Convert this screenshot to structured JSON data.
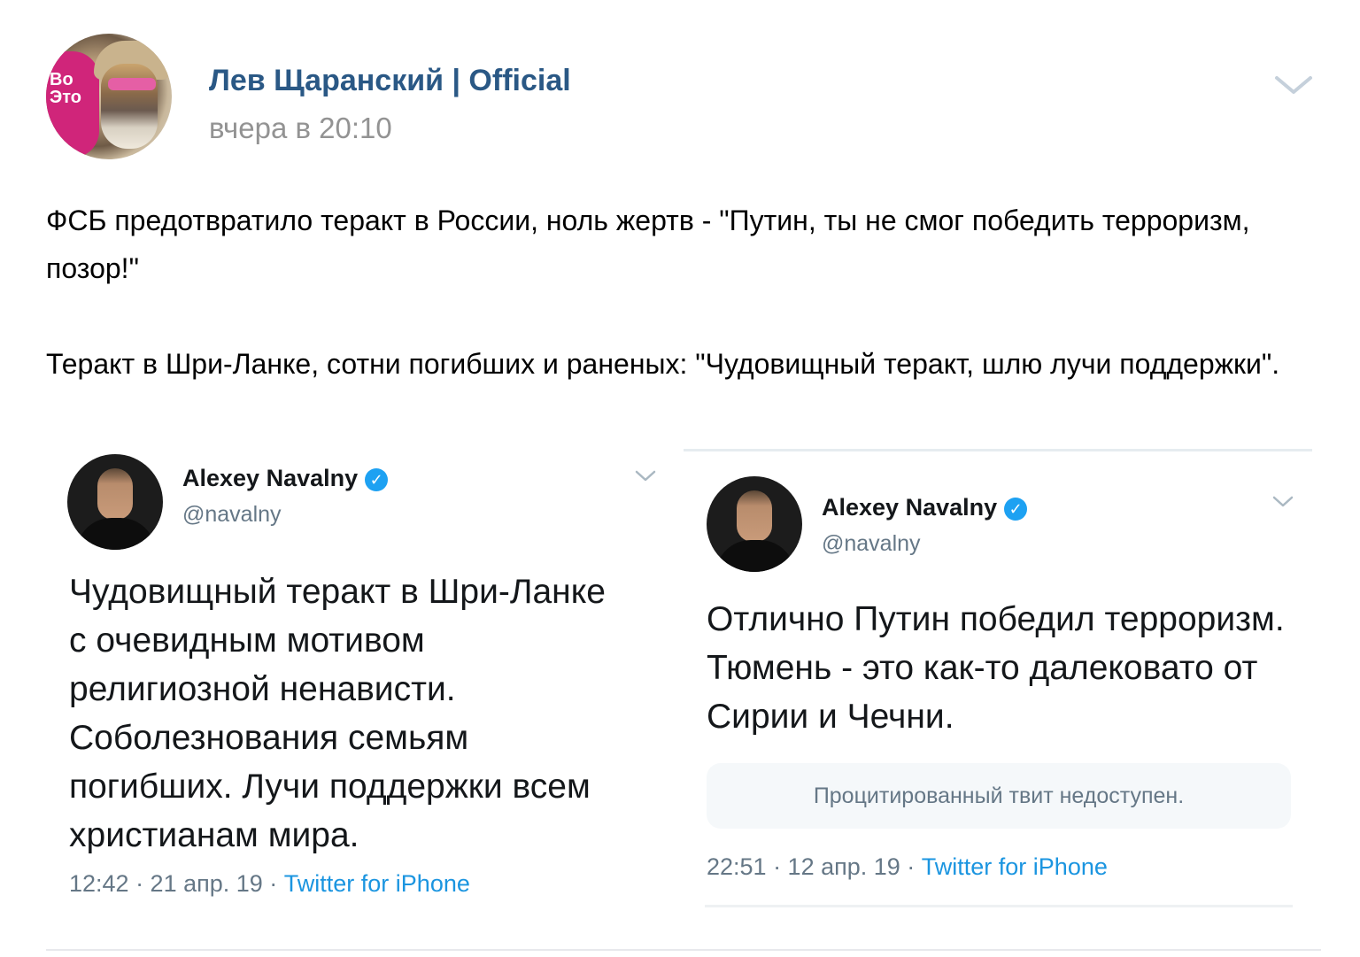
{
  "post": {
    "author": "Лев Щаранский | Official",
    "time": "вчера в 20:10",
    "avatar_text": "Во\nЭто",
    "text": [
      "ФСБ предотвратило теракт в России, ноль жертв - \"Путин, ты не смог победить терроризм, позор!\"",
      "Теракт в Шри-Ланке, сотни погибших и раненых: \"Чудовищный теракт, шлю лучи поддержки\"."
    ]
  },
  "tweets": [
    {
      "name": "Alexey Navalny",
      "handle": "@navalny",
      "text": "Чудовищный теракт в Шри-Ланке с очевидным мотивом религиозной ненависти. Соболезнования семьям погибших. Лучи поддержки всем христианам мира.",
      "meta": "12:42 · 21 апр. 19 · ",
      "source": "Twitter for iPhone"
    },
    {
      "name": "Alexey Navalny",
      "handle": "@navalny",
      "text": "Отлично Путин победил терроризм. Тюмень - это как-то далековато от Сирии и Чечни.",
      "quote": "Процитированный твит недоступен.",
      "meta": "22:51 · 12 апр. 19 · ",
      "source": "Twitter for iPhone"
    }
  ],
  "colors": {
    "author_link": "#2a5885",
    "muted": "#939393",
    "twitter_blue": "#1da1f2",
    "twitter_link": "#1b95e0"
  },
  "icons": {
    "post_menu": "chevron-down-icon",
    "verified": "verified-badge-icon",
    "tweet_menu": "chevron-down-icon"
  }
}
